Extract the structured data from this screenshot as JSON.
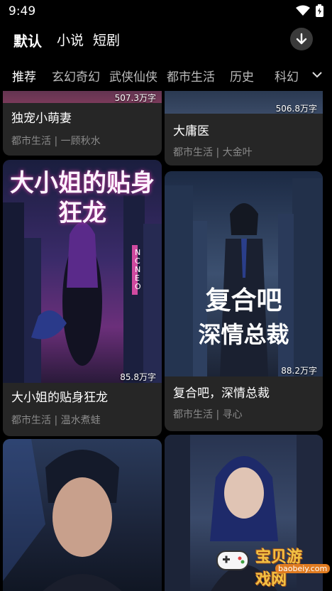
{
  "status": {
    "time": "9:49"
  },
  "top_tabs": [
    "默认",
    "小说",
    "短剧"
  ],
  "categories": [
    "推荐",
    "玄幻奇幻",
    "武侠仙侠",
    "都市生活",
    "历史",
    "科幻"
  ],
  "cards": [
    {
      "title": "独宠小萌妻",
      "meta": "都市生活 | 一顾秋水",
      "words": "507.3万字"
    },
    {
      "title": "大庸医",
      "meta": "都市生活 | 大金叶",
      "words": "506.8万字"
    },
    {
      "title": "大小姐的贴身狂龙",
      "meta": "都市生活 | 温水煮蛙",
      "words": "85.8万字",
      "cover_text": "大小姐的贴身狂龙",
      "cover_sign": "NCNEO"
    },
    {
      "title": "复合吧，深情总裁",
      "meta": "都市生活 | 寻心",
      "words": "88.2万字",
      "cover_text_1": "复合吧",
      "cover_text_2": "深情总裁"
    },
    {
      "title": "",
      "meta": "",
      "words": ""
    },
    {
      "title": "",
      "meta": "",
      "words": ""
    }
  ],
  "watermark": {
    "text": "宝贝游戏网",
    "url": "baobeiy.com"
  },
  "colors": {
    "background": "#000000",
    "card": "#262626",
    "meta": "#8a8a8a"
  }
}
